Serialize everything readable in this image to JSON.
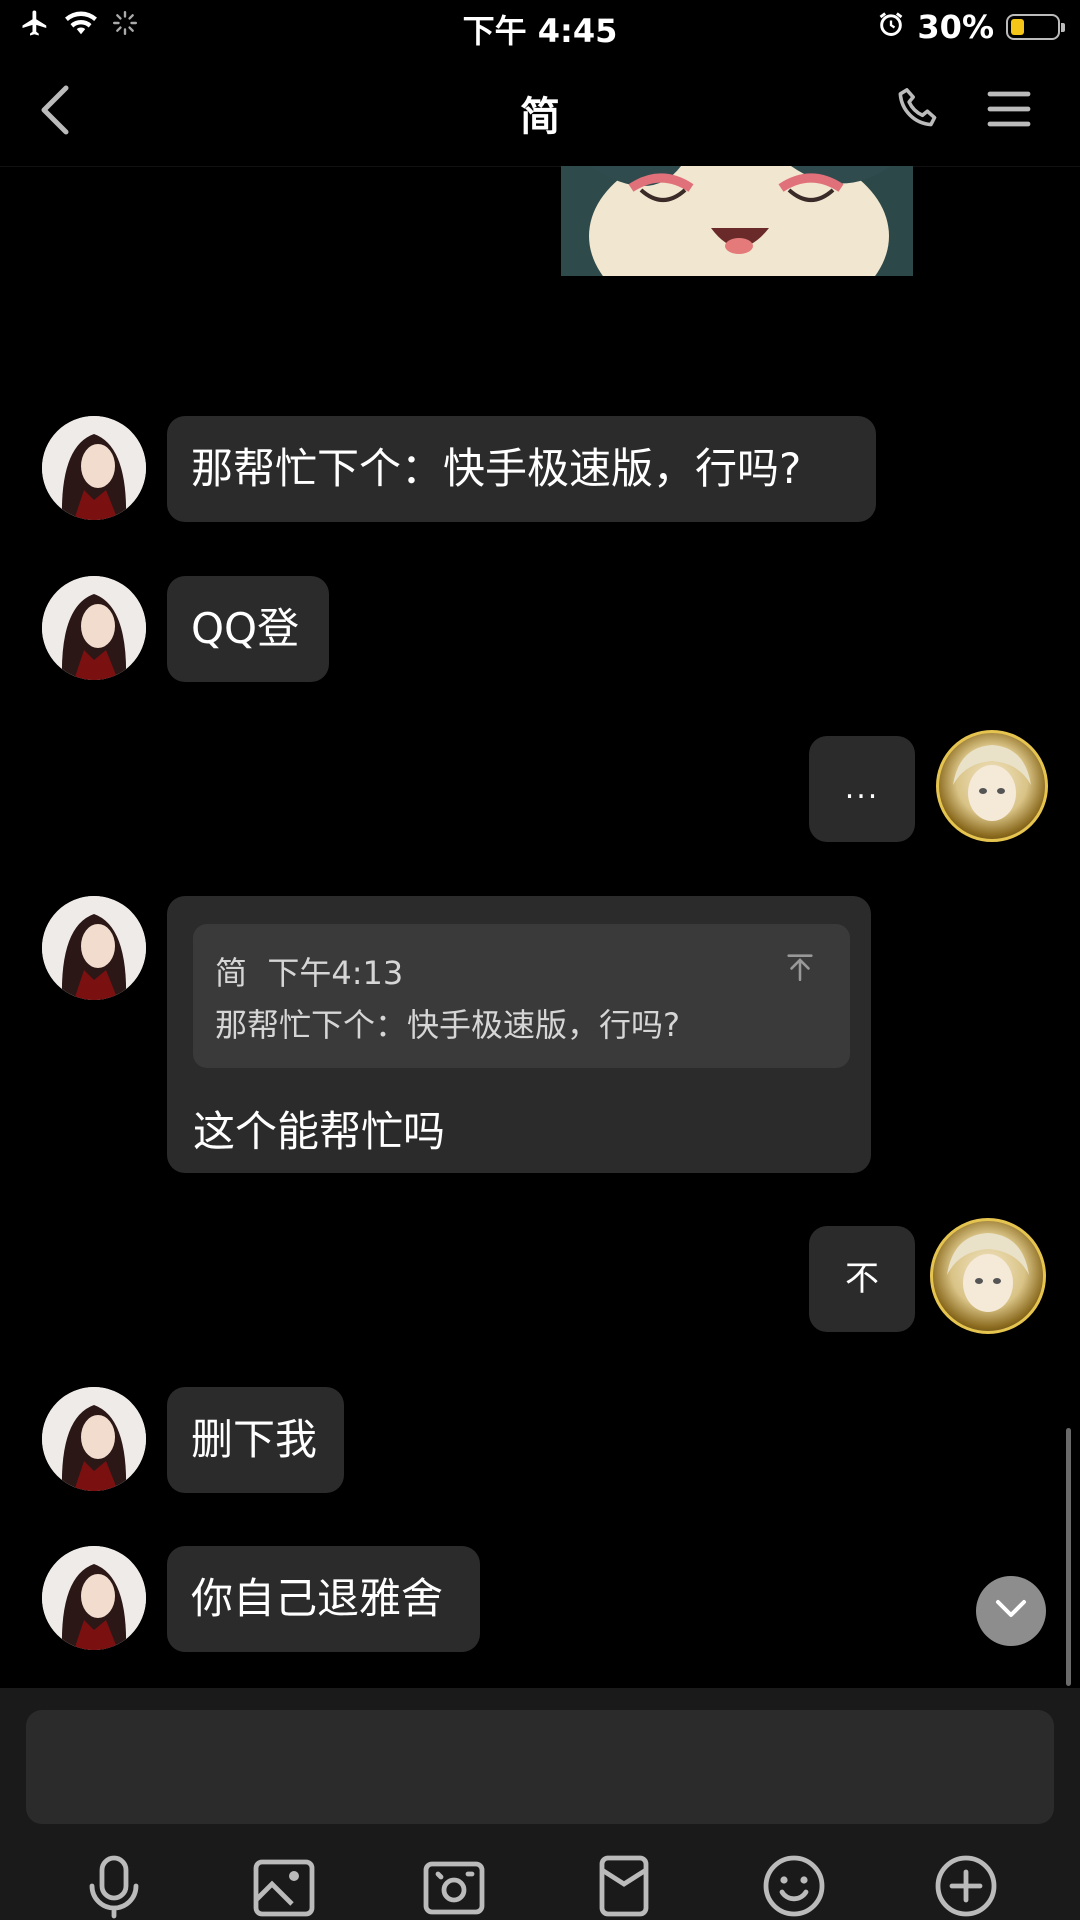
{
  "status_bar": {
    "time": "下午 4:45",
    "battery_percent": "30%",
    "battery_level": 0.3,
    "icons": [
      "airplane-icon",
      "wifi-icon",
      "loading-icon",
      "alarm-icon",
      "battery-icon"
    ]
  },
  "nav": {
    "title": "简",
    "icons": [
      "back-icon",
      "phone-icon",
      "menu-icon"
    ]
  },
  "messages": [
    {
      "side": "left",
      "text": "那帮忙下个：快手极速版，行吗?"
    },
    {
      "side": "left",
      "text": "QQ登"
    },
    {
      "side": "right",
      "text": "..."
    },
    {
      "side": "left",
      "reply": {
        "sender": "简",
        "time": "下午4:13",
        "quote": "那帮忙下个：快手极速版，行吗?"
      },
      "text": "这个能帮忙吗"
    },
    {
      "side": "right",
      "text": "不"
    },
    {
      "side": "left",
      "text": "删下我"
    },
    {
      "side": "left",
      "text": "你自己退雅舍"
    }
  ],
  "input": {
    "placeholder": ""
  },
  "toolbar": {
    "icons": [
      "microphone-icon",
      "image-icon",
      "camera-icon",
      "red-packet-icon",
      "emoji-icon",
      "plus-icon"
    ]
  },
  "colors": {
    "background": "#000000",
    "bubble": "#2b2b2b",
    "battery": "#f5c518"
  }
}
